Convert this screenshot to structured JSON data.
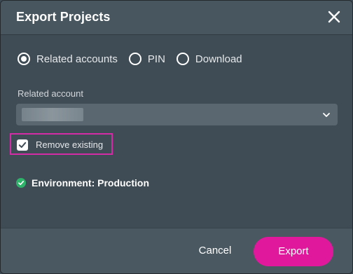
{
  "dialog": {
    "title": "Export Projects"
  },
  "export_mode": {
    "options": [
      {
        "label": "Related accounts",
        "selected": true
      },
      {
        "label": "PIN",
        "selected": false
      },
      {
        "label": "Download",
        "selected": false
      }
    ]
  },
  "related_account": {
    "label": "Related account",
    "value": ""
  },
  "remove_existing": {
    "label": "Remove existing",
    "checked": true
  },
  "environment": {
    "text": "Environment: Production",
    "status_color": "#2fb36b"
  },
  "footer": {
    "cancel_label": "Cancel",
    "export_label": "Export",
    "accent_color": "#e0199c"
  },
  "icons": {
    "close": "close-icon",
    "dropdown": "chevron-down-icon",
    "check": "check-icon",
    "status": "check-circle-icon"
  }
}
